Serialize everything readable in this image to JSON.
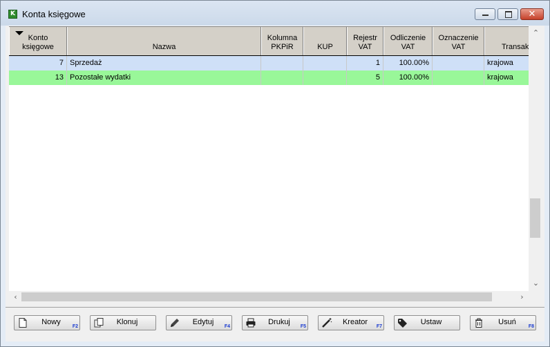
{
  "window": {
    "title": "Konta księgowe",
    "icon": "k-app-icon"
  },
  "columns": [
    {
      "id": "konto",
      "label": "Konto\nksięgowe"
    },
    {
      "id": "nazwa",
      "label": "Nazwa"
    },
    {
      "id": "kolumna",
      "label": "Kolumna\nPKPiR"
    },
    {
      "id": "kup",
      "label": "KUP"
    },
    {
      "id": "rejestr",
      "label": "Rejestr\nVAT"
    },
    {
      "id": "odliczenie",
      "label": "Odliczenie\nVAT"
    },
    {
      "id": "oznaczenie",
      "label": "Oznaczenie\nVAT"
    },
    {
      "id": "transakcja",
      "label": "Transak"
    }
  ],
  "rows": [
    {
      "konto": "7",
      "nazwa": "Sprzedaż",
      "kolumna": "",
      "kup": "",
      "rejestr": "1",
      "odliczenie": "100.00%",
      "oznaczenie": "",
      "transakcja": "krajowa",
      "color": "#cfe0f7"
    },
    {
      "konto": "13",
      "nazwa": "Pozostałe wydatki",
      "kolumna": "",
      "kup": "",
      "rejestr": "5",
      "odliczenie": "100.00%",
      "oznaczenie": "",
      "transakcja": "krajowa",
      "color": "#99f799"
    }
  ],
  "buttons": [
    {
      "id": "nowy",
      "label": "Nowy",
      "key": "F2",
      "icon": "new-document-icon"
    },
    {
      "id": "klonuj",
      "label": "Klonuj",
      "key": "",
      "icon": "clone-icon"
    },
    {
      "id": "edytuj",
      "label": "Edytuj",
      "key": "F4",
      "icon": "pencil-icon"
    },
    {
      "id": "drukuj",
      "label": "Drukuj",
      "key": "F5",
      "icon": "printer-icon"
    },
    {
      "id": "kreator",
      "label": "Kreator",
      "key": "F7",
      "icon": "magic-wand-icon"
    },
    {
      "id": "ustaw",
      "label": "Ustaw",
      "key": "",
      "icon": "tag-icon"
    },
    {
      "id": "usun",
      "label": "Usuń",
      "key": "F8",
      "icon": "trash-icon"
    }
  ]
}
